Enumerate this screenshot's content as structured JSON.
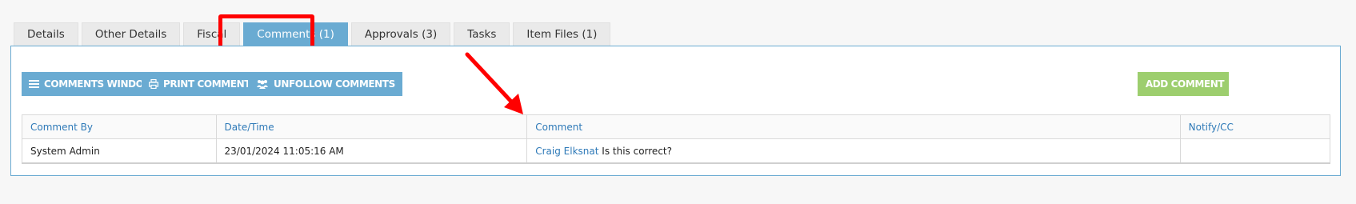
{
  "tabs": [
    {
      "label": "Details"
    },
    {
      "label": "Other Details"
    },
    {
      "label": "Fiscal"
    },
    {
      "label": "Comments (1)"
    },
    {
      "label": "Approvals (3)"
    },
    {
      "label": "Tasks"
    },
    {
      "label": "Item Files (1)"
    }
  ],
  "active_tab": "Comments (1)",
  "toolbar": {
    "comments_window_label": "COMMENTS WINDOW",
    "print_comments_label": "PRINT COMMENTS",
    "unfollow_comments_label": "UNFOLLOW COMMENTS",
    "add_comment_label": "ADD COMMENT"
  },
  "table": {
    "headers": [
      "Comment By",
      "Date/Time",
      "Comment",
      "Notify/CC"
    ],
    "rows": [
      {
        "comment_by": "System Admin",
        "datetime": "23/01/2024 11:05:16 AM",
        "mention": "Craig Elksnat",
        "comment_text": "Is this correct?",
        "notify_cc": ""
      }
    ]
  },
  "colors": {
    "accent_blue": "#6aabd2",
    "accent_green": "#9dce6e",
    "annotation_red": "#ff0000",
    "link_blue": "#2f7ab8"
  },
  "icons": {
    "comments_window": "list-icon",
    "print_comments": "printer-icon",
    "unfollow_comments": "users-icon",
    "add_comment": "plus-icon"
  }
}
